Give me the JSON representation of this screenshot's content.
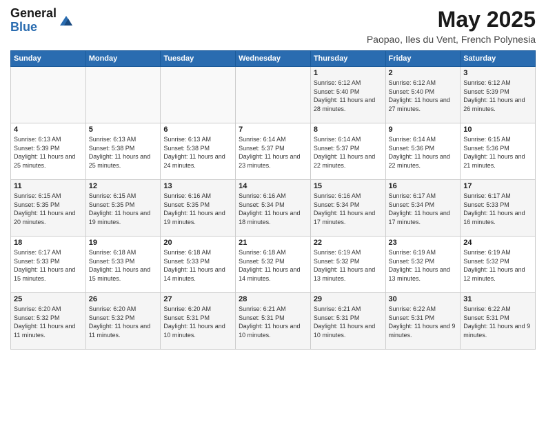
{
  "header": {
    "logo_general": "General",
    "logo_blue": "Blue",
    "month_title": "May 2025",
    "location": "Paopao, Iles du Vent, French Polynesia"
  },
  "days_of_week": [
    "Sunday",
    "Monday",
    "Tuesday",
    "Wednesday",
    "Thursday",
    "Friday",
    "Saturday"
  ],
  "weeks": [
    [
      {
        "day": "",
        "info": ""
      },
      {
        "day": "",
        "info": ""
      },
      {
        "day": "",
        "info": ""
      },
      {
        "day": "",
        "info": ""
      },
      {
        "day": "1",
        "info": "Sunrise: 6:12 AM\nSunset: 5:40 PM\nDaylight: 11 hours and 28 minutes."
      },
      {
        "day": "2",
        "info": "Sunrise: 6:12 AM\nSunset: 5:40 PM\nDaylight: 11 hours and 27 minutes."
      },
      {
        "day": "3",
        "info": "Sunrise: 6:12 AM\nSunset: 5:39 PM\nDaylight: 11 hours and 26 minutes."
      }
    ],
    [
      {
        "day": "4",
        "info": "Sunrise: 6:13 AM\nSunset: 5:39 PM\nDaylight: 11 hours and 25 minutes."
      },
      {
        "day": "5",
        "info": "Sunrise: 6:13 AM\nSunset: 5:38 PM\nDaylight: 11 hours and 25 minutes."
      },
      {
        "day": "6",
        "info": "Sunrise: 6:13 AM\nSunset: 5:38 PM\nDaylight: 11 hours and 24 minutes."
      },
      {
        "day": "7",
        "info": "Sunrise: 6:14 AM\nSunset: 5:37 PM\nDaylight: 11 hours and 23 minutes."
      },
      {
        "day": "8",
        "info": "Sunrise: 6:14 AM\nSunset: 5:37 PM\nDaylight: 11 hours and 22 minutes."
      },
      {
        "day": "9",
        "info": "Sunrise: 6:14 AM\nSunset: 5:36 PM\nDaylight: 11 hours and 22 minutes."
      },
      {
        "day": "10",
        "info": "Sunrise: 6:15 AM\nSunset: 5:36 PM\nDaylight: 11 hours and 21 minutes."
      }
    ],
    [
      {
        "day": "11",
        "info": "Sunrise: 6:15 AM\nSunset: 5:35 PM\nDaylight: 11 hours and 20 minutes."
      },
      {
        "day": "12",
        "info": "Sunrise: 6:15 AM\nSunset: 5:35 PM\nDaylight: 11 hours and 19 minutes."
      },
      {
        "day": "13",
        "info": "Sunrise: 6:16 AM\nSunset: 5:35 PM\nDaylight: 11 hours and 19 minutes."
      },
      {
        "day": "14",
        "info": "Sunrise: 6:16 AM\nSunset: 5:34 PM\nDaylight: 11 hours and 18 minutes."
      },
      {
        "day": "15",
        "info": "Sunrise: 6:16 AM\nSunset: 5:34 PM\nDaylight: 11 hours and 17 minutes."
      },
      {
        "day": "16",
        "info": "Sunrise: 6:17 AM\nSunset: 5:34 PM\nDaylight: 11 hours and 17 minutes."
      },
      {
        "day": "17",
        "info": "Sunrise: 6:17 AM\nSunset: 5:33 PM\nDaylight: 11 hours and 16 minutes."
      }
    ],
    [
      {
        "day": "18",
        "info": "Sunrise: 6:17 AM\nSunset: 5:33 PM\nDaylight: 11 hours and 15 minutes."
      },
      {
        "day": "19",
        "info": "Sunrise: 6:18 AM\nSunset: 5:33 PM\nDaylight: 11 hours and 15 minutes."
      },
      {
        "day": "20",
        "info": "Sunrise: 6:18 AM\nSunset: 5:33 PM\nDaylight: 11 hours and 14 minutes."
      },
      {
        "day": "21",
        "info": "Sunrise: 6:18 AM\nSunset: 5:32 PM\nDaylight: 11 hours and 14 minutes."
      },
      {
        "day": "22",
        "info": "Sunrise: 6:19 AM\nSunset: 5:32 PM\nDaylight: 11 hours and 13 minutes."
      },
      {
        "day": "23",
        "info": "Sunrise: 6:19 AM\nSunset: 5:32 PM\nDaylight: 11 hours and 13 minutes."
      },
      {
        "day": "24",
        "info": "Sunrise: 6:19 AM\nSunset: 5:32 PM\nDaylight: 11 hours and 12 minutes."
      }
    ],
    [
      {
        "day": "25",
        "info": "Sunrise: 6:20 AM\nSunset: 5:32 PM\nDaylight: 11 hours and 11 minutes."
      },
      {
        "day": "26",
        "info": "Sunrise: 6:20 AM\nSunset: 5:32 PM\nDaylight: 11 hours and 11 minutes."
      },
      {
        "day": "27",
        "info": "Sunrise: 6:20 AM\nSunset: 5:31 PM\nDaylight: 11 hours and 10 minutes."
      },
      {
        "day": "28",
        "info": "Sunrise: 6:21 AM\nSunset: 5:31 PM\nDaylight: 11 hours and 10 minutes."
      },
      {
        "day": "29",
        "info": "Sunrise: 6:21 AM\nSunset: 5:31 PM\nDaylight: 11 hours and 10 minutes."
      },
      {
        "day": "30",
        "info": "Sunrise: 6:22 AM\nSunset: 5:31 PM\nDaylight: 11 hours and 9 minutes."
      },
      {
        "day": "31",
        "info": "Sunrise: 6:22 AM\nSunset: 5:31 PM\nDaylight: 11 hours and 9 minutes."
      }
    ]
  ]
}
